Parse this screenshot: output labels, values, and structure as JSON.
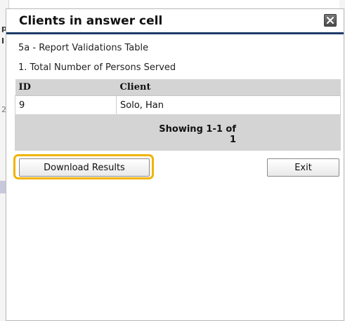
{
  "dialog": {
    "title": "Clients in answer cell",
    "subtitle": "5a - Report Validations Table",
    "question": "1. Total Number of Persons Served"
  },
  "table": {
    "columns": [
      "ID",
      "Client"
    ],
    "rows": [
      {
        "id": "9",
        "client": "Solo, Han"
      }
    ]
  },
  "pager": {
    "line1": "Showing 1-1 of",
    "line2": "1"
  },
  "buttons": {
    "download": "Download Results",
    "exit": "Exit"
  },
  "background": {
    "fragment_1": "p",
    "fragment_2": "I",
    "fragment_3": "2"
  },
  "colors": {
    "title_underline": "#1f3a68",
    "highlight": "#f0b400",
    "header_bg": "#d4d4d4"
  },
  "icons": {
    "close": "close-icon"
  }
}
